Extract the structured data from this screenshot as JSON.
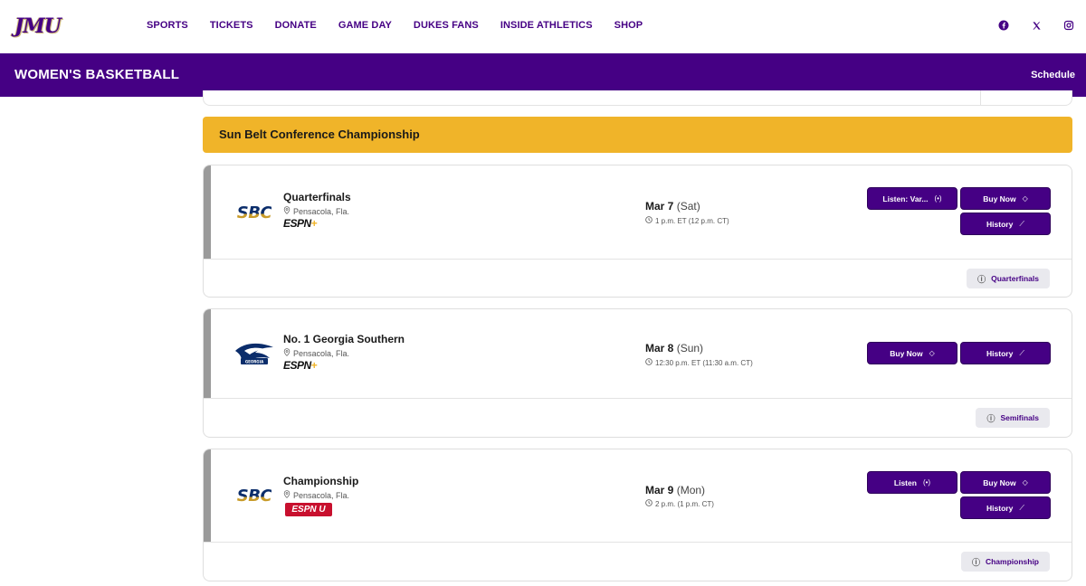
{
  "brand": {
    "logo_text": "JMU"
  },
  "nav": {
    "items": [
      "SPORTS",
      "TICKETS",
      "DONATE",
      "GAME DAY",
      "DUKES FANS",
      "INSIDE ATHLETICS",
      "SHOP"
    ]
  },
  "social": [
    "facebook-icon",
    "x-icon",
    "instagram-icon"
  ],
  "band": {
    "title": "WOMEN'S BASKETBALL",
    "link": "Schedule"
  },
  "section": {
    "title": "Sun Belt Conference Championship"
  },
  "games": [
    {
      "opponent": "Quarterfinals",
      "logo": "SBC",
      "location": "Pensacola, Fla.",
      "tv": "ESPN",
      "date": "Mar 7",
      "dow": "(Sat)",
      "time": "1 p.m. ET (12 p.m. CT)",
      "buttons": {
        "listen": "Listen: Var...",
        "buy": "Buy Now",
        "history": "History"
      },
      "round": "Quarterfinals"
    },
    {
      "opponent": "No. 1 Georgia Southern",
      "logo": "Georgia Southern",
      "location": "Pensacola, Fla.",
      "tv": "ESPN",
      "date": "Mar 8",
      "dow": "(Sun)",
      "time": "12:30 p.m. ET (11:30 a.m. CT)",
      "buttons": {
        "buy": "Buy Now",
        "history": "History"
      },
      "round": "Semifinals"
    },
    {
      "opponent": "Championship",
      "logo": "SBC",
      "location": "Pensacola, Fla.",
      "tv": "ESPN U",
      "date": "Mar 9",
      "dow": "(Mon)",
      "time": "2 p.m. (1 p.m. CT)",
      "buttons": {
        "listen": "Listen",
        "buy": "Buy Now",
        "history": "History"
      },
      "round": "Championship"
    }
  ],
  "colors": {
    "purple": "#450084",
    "gold": "#f0b429",
    "stripe": "#9a9a9a"
  }
}
